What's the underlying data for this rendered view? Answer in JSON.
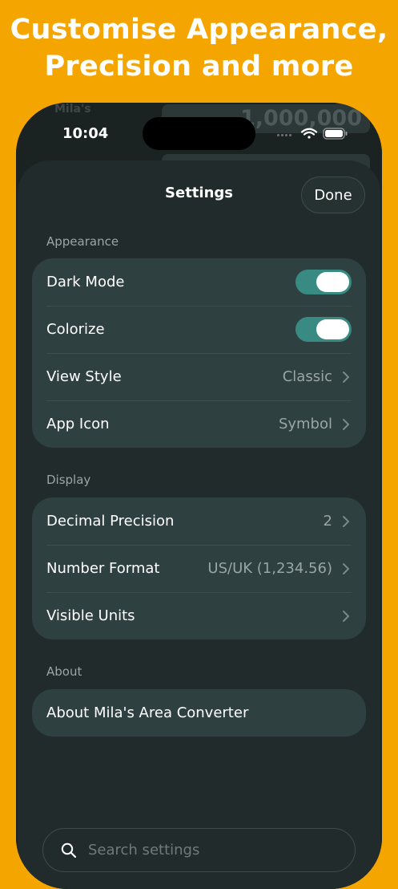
{
  "promo": {
    "line1": "Customise Appearance,",
    "line2": "Precision and more"
  },
  "background_app": {
    "label": "Mila's",
    "value": "1,000,000"
  },
  "status_bar": {
    "time": "10:04",
    "icons": [
      "cellular-icon",
      "wifi-icon",
      "battery-icon"
    ]
  },
  "header": {
    "title": "Settings",
    "done_label": "Done"
  },
  "appearance": {
    "section_label": "Appearance",
    "rows": [
      {
        "label": "Dark Mode",
        "toggle": true
      },
      {
        "label": "Colorize",
        "toggle": true
      },
      {
        "label": "View Style",
        "value": "Classic"
      },
      {
        "label": "App Icon",
        "value": "Symbol"
      }
    ]
  },
  "display": {
    "section_label": "Display",
    "rows": [
      {
        "label": "Decimal Precision",
        "value": "2"
      },
      {
        "label": "Number Format",
        "value": "US/UK (1,234.56)"
      },
      {
        "label": "Visible Units",
        "value": ""
      }
    ]
  },
  "about": {
    "section_label": "About",
    "rows": [
      {
        "label": "About Mila's Area Converter"
      }
    ]
  },
  "search": {
    "placeholder": "Search settings",
    "value": ""
  },
  "colors": {
    "background": "#F5A500",
    "sheet": "#212B2B",
    "group": "#2E4040",
    "toggle_on": "#3A8A84"
  }
}
